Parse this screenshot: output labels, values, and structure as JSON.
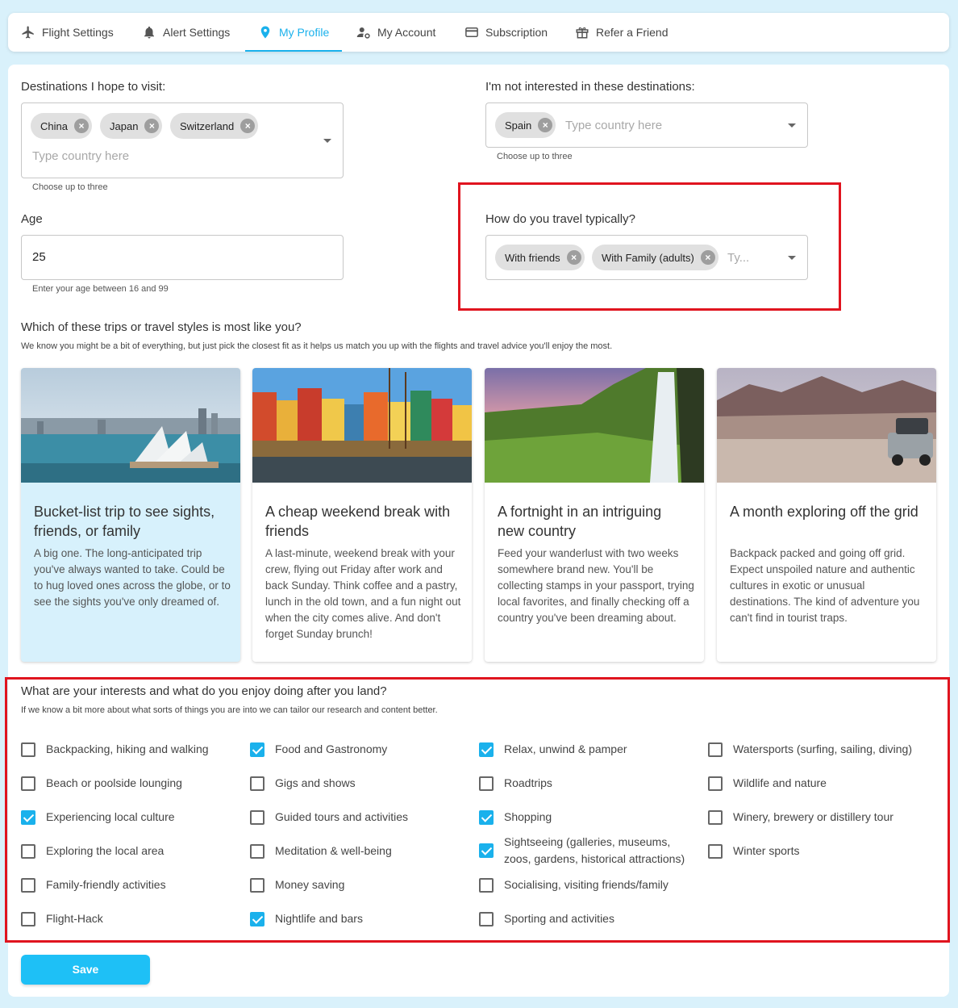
{
  "tabs": [
    {
      "label": "Flight Settings",
      "icon": "airplane-icon"
    },
    {
      "label": "Alert Settings",
      "icon": "bell-icon"
    },
    {
      "label": "My Profile",
      "icon": "location-pin-icon"
    },
    {
      "label": "My Account",
      "icon": "user-gear-icon"
    },
    {
      "label": "Subscription",
      "icon": "credit-card-icon"
    },
    {
      "label": "Refer a Friend",
      "icon": "gift-icon"
    }
  ],
  "active_tab": "My Profile",
  "colors": {
    "accent": "#1ab1ec",
    "highlight": "#e0141f",
    "selected_card": "#d7f1fc"
  },
  "destinations": {
    "label": "Destinations I hope to visit:",
    "chips": [
      "China",
      "Japan",
      "Switzerland"
    ],
    "placeholder": "Type country here",
    "helper": "Choose up to three"
  },
  "not_interested": {
    "label": "I'm not interested in these destinations:",
    "chips": [
      "Spain"
    ],
    "placeholder": "Type country here",
    "helper": "Choose up to three"
  },
  "age": {
    "label": "Age",
    "value": "25",
    "helper": "Enter your age between 16 and 99"
  },
  "travel": {
    "label": "How do you travel typically?",
    "chips": [
      "With friends",
      "With Family (adults)"
    ],
    "placeholder": "Ty..."
  },
  "trips": {
    "title": "Which of these trips or travel styles is most like you?",
    "subtitle": "We know you might be a bit of everything, but just pick the closest fit as it helps us match you up with the flights and travel advice you'll enjoy the most.",
    "cards": [
      {
        "title": "Bucket-list trip to see sights, friends, or family",
        "desc": "A big one. The long-anticipated trip you've always wanted to take. Could be to hug loved ones across the globe, or to see the sights you've only dreamed of.",
        "selected": true
      },
      {
        "title": "A cheap weekend break with friends",
        "desc": "A last-minute, weekend break with your crew, flying out Friday after work and back Sunday. Think coffee and a pastry, lunch in the old town, and a fun night out when the city comes alive. And don't forget Sunday brunch!",
        "selected": false
      },
      {
        "title": "A fortnight in an intriguing new country",
        "desc": "Feed your wanderlust with two weeks somewhere brand new. You'll be collecting stamps in your passport, trying local favorites, and finally checking off a country you've been dreaming about.",
        "selected": false
      },
      {
        "title": "A month exploring off the grid",
        "desc": "Backpack packed and going off grid. Expect unspoiled nature and authentic cultures in exotic or unusual destinations. The kind of adventure you can't find in tourist traps.",
        "selected": false
      }
    ]
  },
  "interests": {
    "title": "What are your interests and what do you enjoy doing after you land?",
    "subtitle": "If we know a bit more about what sorts of things you are into we can tailor our research and content better.",
    "columns": [
      [
        {
          "label": "Backpacking, hiking and walking",
          "checked": false
        },
        {
          "label": "Beach or poolside lounging",
          "checked": false
        },
        {
          "label": "Experiencing local culture",
          "checked": true
        },
        {
          "label": "Exploring the local area",
          "checked": false
        },
        {
          "label": "Family-friendly activities",
          "checked": false
        },
        {
          "label": "Flight-Hack",
          "checked": false
        }
      ],
      [
        {
          "label": "Food and Gastronomy",
          "checked": true
        },
        {
          "label": "Gigs and shows",
          "checked": false
        },
        {
          "label": "Guided tours and activities",
          "checked": false
        },
        {
          "label": "Meditation & well-being",
          "checked": false
        },
        {
          "label": "Money saving",
          "checked": false
        },
        {
          "label": "Nightlife and bars",
          "checked": true
        }
      ],
      [
        {
          "label": "Relax, unwind & pamper",
          "checked": true
        },
        {
          "label": "Roadtrips",
          "checked": false
        },
        {
          "label": "Shopping",
          "checked": true
        },
        {
          "label": "Sightseeing (galleries, museums, zoos, gardens, historical attractions)",
          "checked": true
        },
        {
          "label": "Socialising, visiting friends/family",
          "checked": false
        },
        {
          "label": "Sporting and activities",
          "checked": false
        }
      ],
      [
        {
          "label": "Watersports (surfing, sailing, diving)",
          "checked": false
        },
        {
          "label": "Wildlife and nature",
          "checked": false
        },
        {
          "label": "Winery, brewery or distillery tour",
          "checked": false
        },
        {
          "label": "Winter sports",
          "checked": false
        }
      ]
    ]
  },
  "save_label": "Save"
}
